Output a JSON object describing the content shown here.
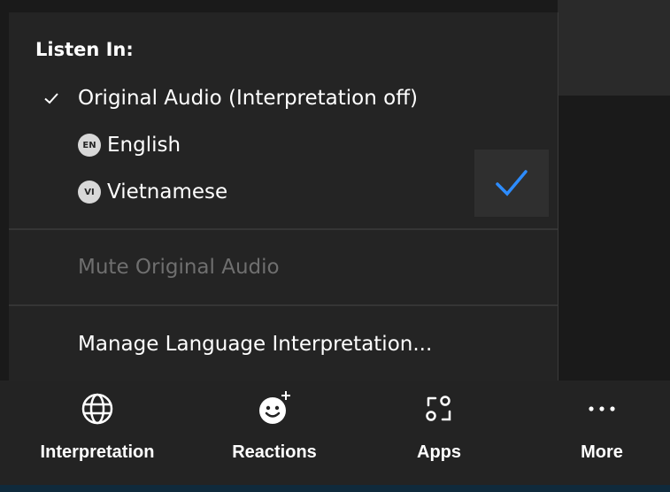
{
  "colors": {
    "menu_bg": "#242424",
    "accent_blue": "#2d8cff",
    "disabled_text": "#6f6f6f",
    "toolbar_bg": "#232323"
  },
  "interpretation_menu": {
    "header": "Listen In:",
    "items": [
      {
        "label": "Original Audio (Interpretation off)",
        "checked": true
      },
      {
        "badge": "EN",
        "label": "English",
        "icon": "language-badge-en"
      },
      {
        "badge": "VI",
        "label": "Vietnamese",
        "icon": "language-badge-vi"
      }
    ],
    "mute_original": {
      "label": "Mute Original Audio",
      "disabled": true
    },
    "manage": {
      "label": "Manage Language Interpretation..."
    }
  },
  "toolbar": {
    "buttons": [
      {
        "label": "Interpretation",
        "icon": "globe-icon"
      },
      {
        "label": "Reactions",
        "icon": "smiley-plus-icon"
      },
      {
        "label": "Apps",
        "icon": "apps-icon"
      },
      {
        "label": "More",
        "icon": "more-icon"
      }
    ]
  }
}
